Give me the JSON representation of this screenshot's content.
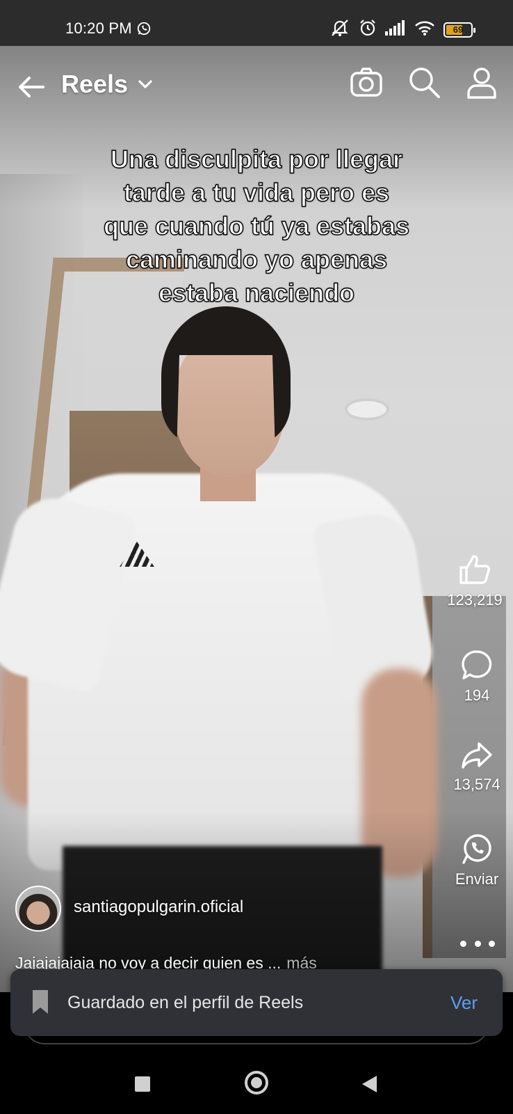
{
  "status_bar": {
    "time": "10:20 PM",
    "battery": "69",
    "battery_level": 0.69,
    "icons": [
      "whatsapp-icon",
      "mute-icon",
      "alarm-icon",
      "signal-icon",
      "wifi-icon",
      "battery-icon"
    ]
  },
  "app_bar": {
    "title": "Reels",
    "icons": [
      "back-arrow-icon",
      "chevron-down-icon",
      "camera-icon",
      "search-icon",
      "profile-icon"
    ]
  },
  "caption": {
    "lines": [
      "Una disculpita por llegar",
      "tarde a tu vida pero es",
      "que cuando tú ya estabas",
      "caminando yo apenas",
      "estaba naciendo"
    ]
  },
  "actions": {
    "likes": "123,219",
    "comments": "194",
    "shares": "13,574",
    "send_label": "Enviar",
    "icons": [
      "like-icon",
      "comment-icon",
      "share-icon",
      "whatsapp-icon",
      "more-icon"
    ]
  },
  "post": {
    "author": "santiagopulgarin.oficial",
    "text": "Jajajajajaja no voy a decir quien es ...",
    "more_label": "más"
  },
  "snackbar": {
    "message": "Guardado en el perfil de Reels",
    "action": "Ver",
    "action_color": "#5e9ff2"
  },
  "nav_bar": {
    "icons": [
      "recents-icon",
      "home-icon",
      "back-icon"
    ]
  }
}
